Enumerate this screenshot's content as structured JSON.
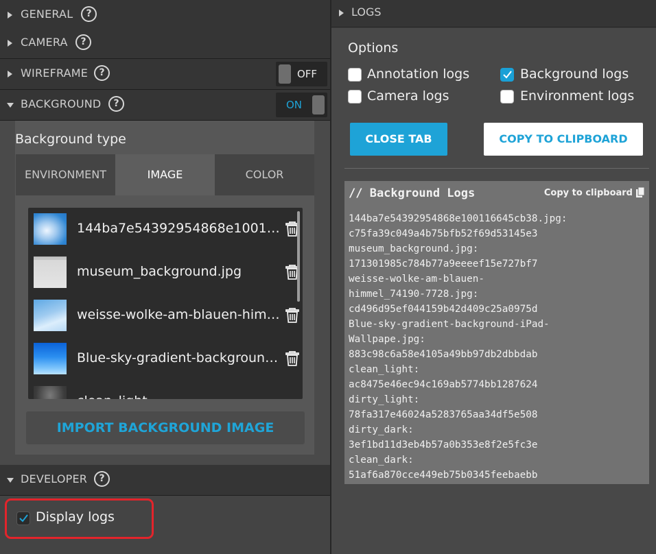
{
  "left_panel": {
    "sections": {
      "general": {
        "title": "GENERAL",
        "help": "?"
      },
      "camera": {
        "title": "CAMERA",
        "help": "?"
      },
      "wireframe": {
        "title": "WIREFRAME",
        "help": "?",
        "toggle": "OFF"
      },
      "background": {
        "title": "BACKGROUND",
        "help": "?",
        "toggle": "ON"
      },
      "developer": {
        "title": "DEVELOPER",
        "help": "?"
      }
    },
    "background": {
      "type_label": "Background type",
      "tabs": [
        {
          "label": "ENVIRONMENT",
          "active": false
        },
        {
          "label": "IMAGE",
          "active": true
        },
        {
          "label": "COLOR",
          "active": false
        }
      ],
      "images": [
        {
          "name": "144ba7e54392954868e100116645cb38.jpg"
        },
        {
          "name": "museum_background.jpg"
        },
        {
          "name": "weisse-wolke-am-blauen-himmel_74190-7728.jpg"
        },
        {
          "name": "Blue-sky-gradient-background-iPad-Wallpape.jpg"
        },
        {
          "name": "clean_light"
        }
      ],
      "import_label": "IMPORT BACKGROUND IMAGE"
    },
    "developer": {
      "display_logs_label": "Display logs",
      "display_logs_checked": true
    }
  },
  "logs_panel": {
    "title": "LOGS",
    "options_label": "Options",
    "options": {
      "annotation": {
        "label": "Annotation logs",
        "checked": false
      },
      "background": {
        "label": "Background logs",
        "checked": true
      },
      "camera": {
        "label": "Camera logs",
        "checked": false
      },
      "environment": {
        "label": "Environment logs",
        "checked": false
      }
    },
    "close_tab_label": "CLOSE TAB",
    "copy_to_clipboard_label": "COPY TO CLIPBOARD",
    "log_box": {
      "title": "// Background Logs",
      "copy_label": "Copy to clipboard",
      "lines": [
        "144ba7e54392954868e100116645cb38.jpg:",
        "c75fa39c049a4b75bfb52f69d53145e3",
        "museum_background.jpg:",
        "171301985c784b77a9eeeef15e727bf7",
        "weisse-wolke-am-blauen-",
        "himmel_74190-7728.jpg:",
        "cd496d95ef044159b42d409c25a0975d",
        "Blue-sky-gradient-background-iPad-",
        "Wallpape.jpg:",
        "883c98c6a58e4105a49bb97db2dbbdab",
        "clean_light:",
        "ac8475e46ec94c169ab5774bb1287624",
        "dirty_light:",
        "78fa317e46024a5283765aa34df5e508",
        "dirty_dark:",
        "3ef1bd11d3eb4b57a0b353e8f2e5fc3e",
        "clean_dark:",
        "51af6a870cce449eb75b0345feebaebb"
      ]
    }
  },
  "colors": {
    "accent": "#1ea3d7",
    "highlight_border": "#e3242b"
  }
}
